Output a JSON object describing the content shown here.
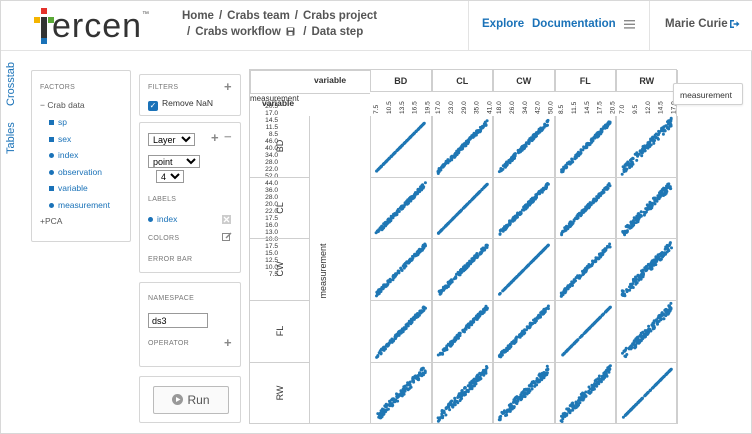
{
  "app": {
    "logo_text": "ercen",
    "logo_mark": "™"
  },
  "breadcrumb": {
    "line1": [
      "Home",
      "Crabs team",
      "Crabs project"
    ],
    "line2": [
      "Crabs workflow",
      "Data step"
    ],
    "sep": "/"
  },
  "nav": {
    "explore": "Explore",
    "documentation": "Documentation",
    "user": "Marie Curie"
  },
  "side_tabs": {
    "crosstab": "Crosstab",
    "tables": "Tables"
  },
  "factors": {
    "title": "FACTORS",
    "group": "Crab data",
    "items": [
      {
        "label": "sp",
        "icon": "square"
      },
      {
        "label": "sex",
        "icon": "square"
      },
      {
        "label": "index",
        "icon": "circle"
      },
      {
        "label": "observation",
        "icon": "circle"
      },
      {
        "label": "variable",
        "icon": "square"
      },
      {
        "label": "measurement",
        "icon": "circle"
      }
    ],
    "pca": "PCA",
    "pca_prefix": "+"
  },
  "filters": {
    "title": "FILTERS",
    "remove_nan": "Remove NaN",
    "remove_nan_checked": true
  },
  "layer": {
    "layer_value": "Layer 1",
    "chart_type": "point",
    "size_value": "4",
    "labels_title": "LABELS",
    "label_item": "index",
    "colors_title": "COLORS",
    "error_bar_title": "ERROR BAR"
  },
  "namespace": {
    "title": "NAMESPACE",
    "value": "ds3",
    "operator_title": "OPERATOR"
  },
  "run": {
    "label": "Run"
  },
  "grid": {
    "corner_top": "variable",
    "corner_left": "variable",
    "measurement_label": "measurement",
    "col_header_measurement": "measurement",
    "popup": "measurement",
    "cols": [
      {
        "name": "BD",
        "ticks": [
          "7.5",
          "10.5",
          "13.5",
          "16.5",
          "19.5"
        ]
      },
      {
        "name": "CL",
        "ticks": [
          "17.0",
          "23.0",
          "29.0",
          "35.0",
          "41.0"
        ]
      },
      {
        "name": "CW",
        "ticks": [
          "18.0",
          "26.0",
          "34.0",
          "42.0",
          "50.0"
        ]
      },
      {
        "name": "FL",
        "ticks": [
          "8.5",
          "11.5",
          "14.5",
          "17.5",
          "20.5"
        ]
      },
      {
        "name": "RW",
        "ticks": [
          "7.0",
          "9.5",
          "12.0",
          "14.5",
          "17.0"
        ]
      }
    ],
    "rows": [
      {
        "name": "BD",
        "ticks": [
          "20.5",
          "17.0",
          "14.5",
          "11.5",
          "8.5"
        ]
      },
      {
        "name": "CL",
        "ticks": [
          "46.0",
          "40.0",
          "34.0",
          "28.0",
          "22.0"
        ]
      },
      {
        "name": "CW",
        "ticks": [
          "52.0",
          "44.0",
          "36.0",
          "28.0",
          "20.0"
        ]
      },
      {
        "name": "FL",
        "ticks": [
          "22.0",
          "17.5",
          "16.0",
          "13.0",
          "10.0"
        ]
      },
      {
        "name": "RW",
        "ticks": [
          "17.5",
          "15.0",
          "12.5",
          "10.0",
          "7.5"
        ]
      }
    ]
  },
  "colors": {
    "accent": "#1a72b8",
    "point": "#1f77b4",
    "logo_red": "#e4312b",
    "logo_yellow": "#f4b400",
    "logo_green": "#5aa837",
    "logo_blue": "#1a72b8"
  }
}
